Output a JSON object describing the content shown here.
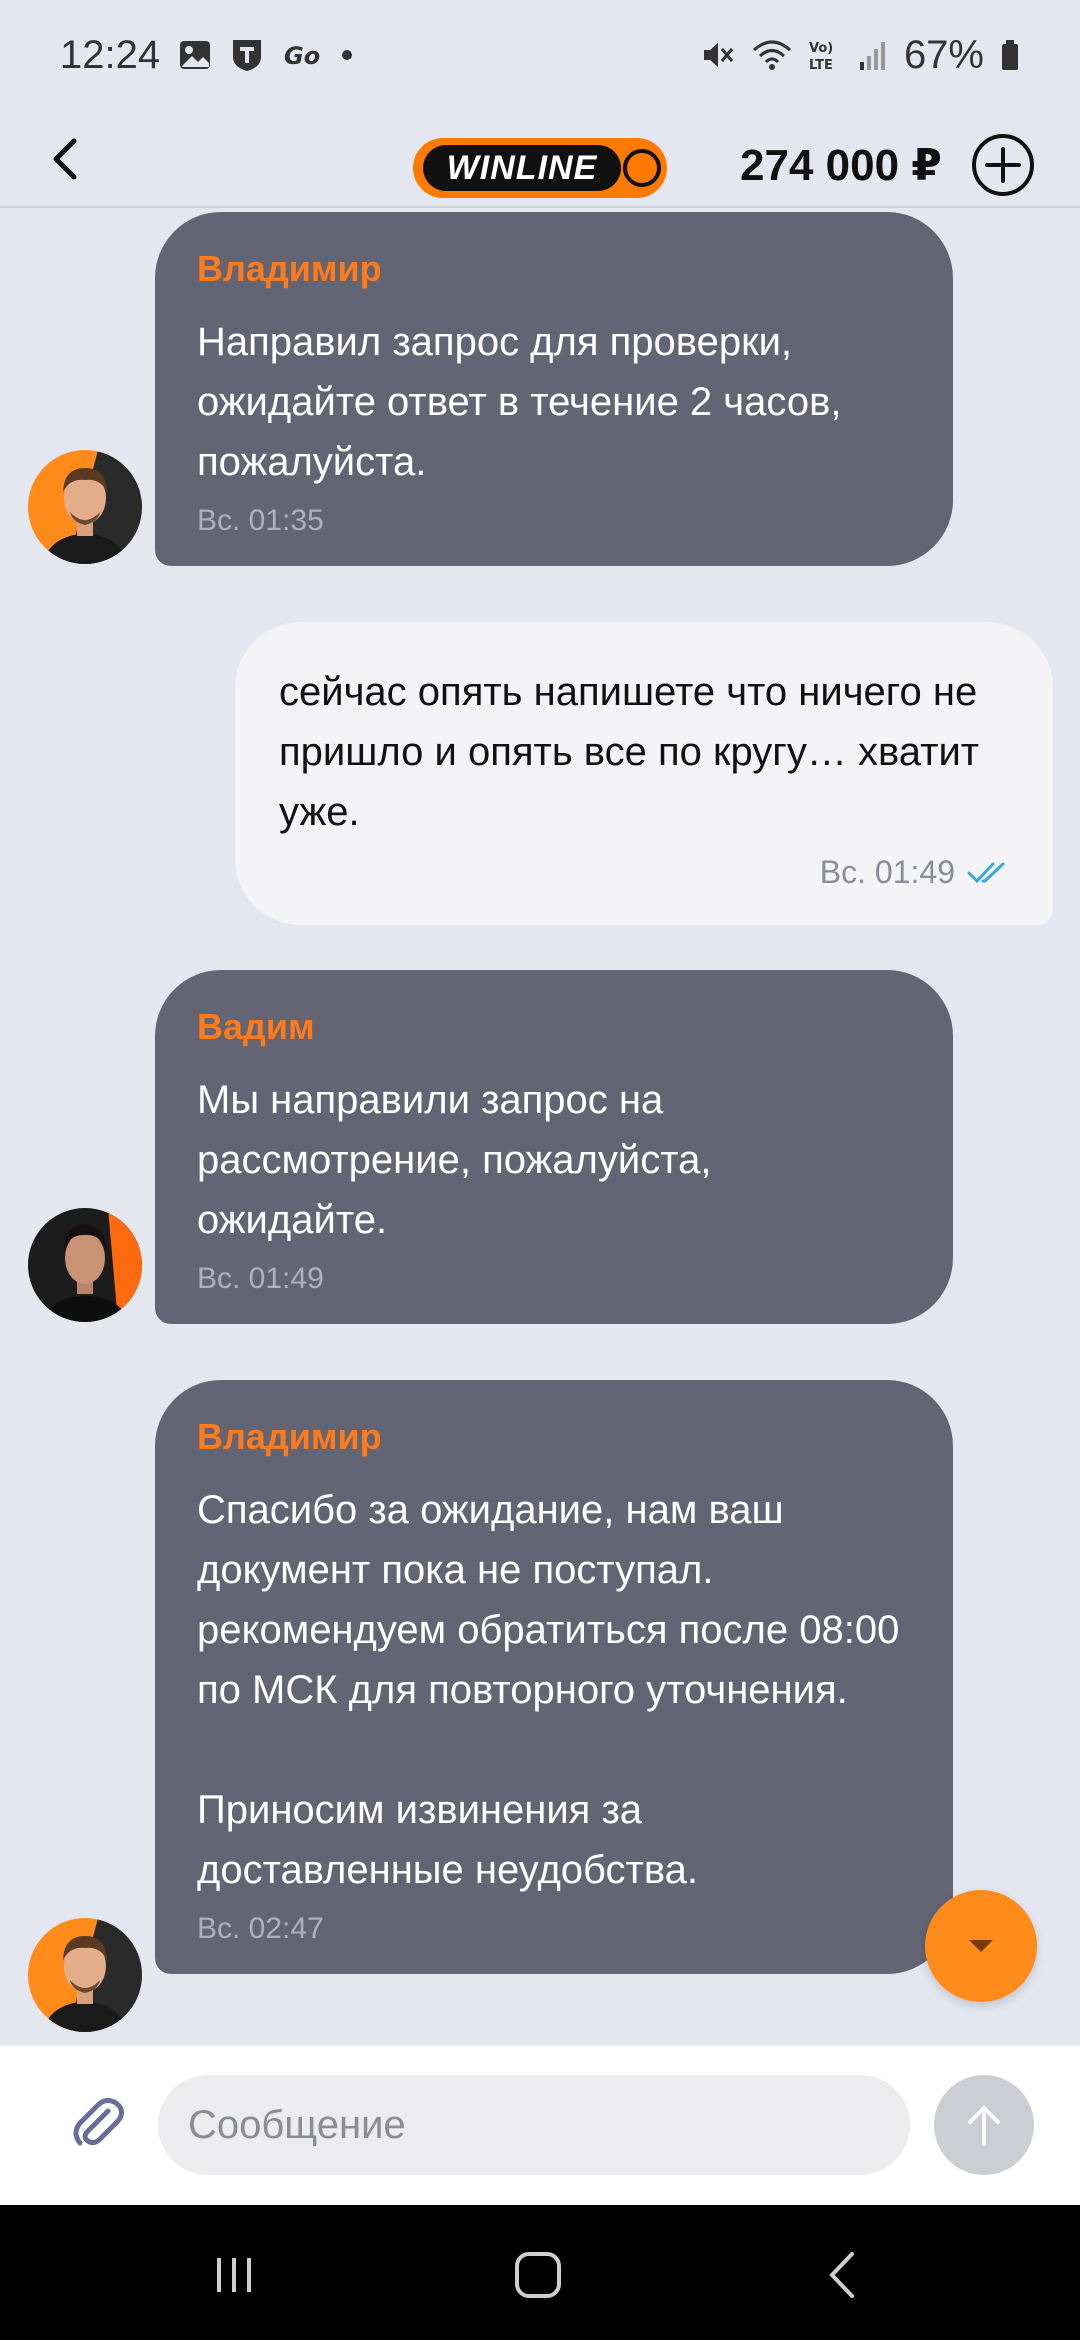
{
  "status_bar": {
    "time": "12:24",
    "battery": "67%"
  },
  "header": {
    "logo_text": "WINLINE",
    "balance": "274 000 ₽"
  },
  "messages": [
    {
      "sender": "Владимир",
      "text": "Направил запрос для проверки, ожидайте ответ в течение 2 часов, пожалуйста.",
      "time": "Вс. 01:35",
      "avatar": "man-orange-avatar"
    },
    {
      "text": "сейчас опять напишете что ничего не пришло и опять все по кругу… хватит уже.",
      "time": "Вс. 01:49",
      "read": true
    },
    {
      "sender": "Вадим",
      "text": "Мы направили запрос на рассмотрение, пожалуйста, ожидайте.",
      "time": "Вс. 01:49",
      "avatar": "man-dark-avatar"
    },
    {
      "sender": "Владимир",
      "text": "Спасибо за ожидание, нам ваш документ пока не поступал. рекомендуем обратиться после 08:00 по МСК для повторного уточнения.\n\nПриносим извинения за доставленные неудобства.",
      "time": "Вс. 02:47",
      "avatar": "man-orange-avatar"
    }
  ],
  "input": {
    "placeholder": "Сообщение"
  },
  "colors": {
    "accent": "#ff7a1a",
    "operator_bubble": "#636574",
    "user_bubble": "#f4f4f6",
    "background": "#e4e7f0",
    "read_check": "#3aa8d8"
  }
}
